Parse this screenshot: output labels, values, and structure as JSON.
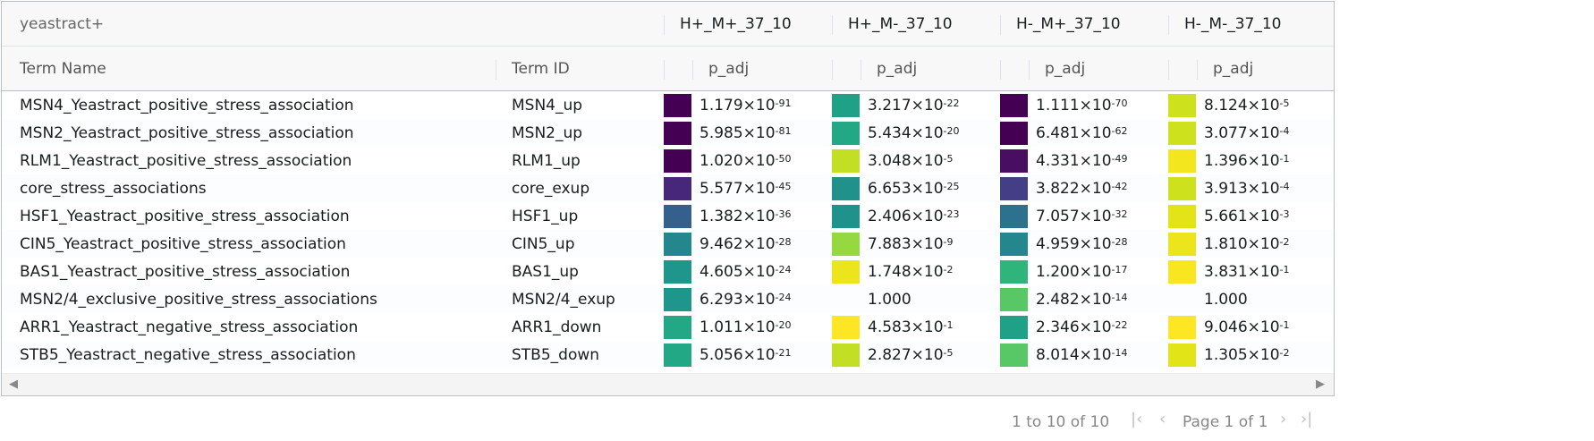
{
  "group_header": {
    "title": "yeastract+",
    "columns": [
      "H+_M+_37_10",
      "H+_M-_37_10",
      "H-_M+_37_10",
      "H-_M-_37_10"
    ]
  },
  "column_header": {
    "term_name": "Term Name",
    "term_id": "Term ID",
    "p_adj": [
      "p_adj",
      "p_adj",
      "p_adj",
      "p_adj"
    ]
  },
  "rows": [
    {
      "name": "MSN4_Yeastract_positive_stress_association",
      "id": "MSN4_up",
      "cells": [
        {
          "color": "#440154",
          "m": "1.179×10",
          "e": "-91"
        },
        {
          "color": "#1fa188",
          "m": "3.217×10",
          "e": "-22"
        },
        {
          "color": "#440154",
          "m": "1.111×10",
          "e": "-70"
        },
        {
          "color": "#cde11d",
          "m": "8.124×10",
          "e": "-5"
        }
      ]
    },
    {
      "name": "MSN2_Yeastract_positive_stress_association",
      "id": "MSN2_up",
      "cells": [
        {
          "color": "#440154",
          "m": "5.985×10",
          "e": "-81"
        },
        {
          "color": "#22a884",
          "m": "5.434×10",
          "e": "-20"
        },
        {
          "color": "#440154",
          "m": "6.481×10",
          "e": "-62"
        },
        {
          "color": "#cde11d",
          "m": "3.077×10",
          "e": "-4"
        }
      ]
    },
    {
      "name": "RLM1_Yeastract_positive_stress_association",
      "id": "RLM1_up",
      "cells": [
        {
          "color": "#440154",
          "m": "1.020×10",
          "e": "-50"
        },
        {
          "color": "#c2df23",
          "m": "3.048×10",
          "e": "-5"
        },
        {
          "color": "#470e61",
          "m": "4.331×10",
          "e": "-49"
        },
        {
          "color": "#f4e61e",
          "m": "1.396×10",
          "e": "-1"
        }
      ]
    },
    {
      "name": "core_stress_associations",
      "id": "core_exup",
      "cells": [
        {
          "color": "#46277a",
          "m": "5.577×10",
          "e": "-45"
        },
        {
          "color": "#21918c",
          "m": "6.653×10",
          "e": "-25"
        },
        {
          "color": "#433e85",
          "m": "3.822×10",
          "e": "-42"
        },
        {
          "color": "#cde11d",
          "m": "3.913×10",
          "e": "-4"
        }
      ]
    },
    {
      "name": "HSF1_Yeastract_positive_stress_association",
      "id": "HSF1_up",
      "cells": [
        {
          "color": "#355f8d",
          "m": "1.382×10",
          "e": "-36"
        },
        {
          "color": "#20928c",
          "m": "2.406×10",
          "e": "-23"
        },
        {
          "color": "#2c728e",
          "m": "7.057×10",
          "e": "-32"
        },
        {
          "color": "#e2e418",
          "m": "5.661×10",
          "e": "-3"
        }
      ]
    },
    {
      "name": "CIN5_Yeastract_positive_stress_association",
      "id": "CIN5_up",
      "cells": [
        {
          "color": "#24878e",
          "m": "9.462×10",
          "e": "-28"
        },
        {
          "color": "#95d840",
          "m": "7.883×10",
          "e": "-9"
        },
        {
          "color": "#24878e",
          "m": "4.959×10",
          "e": "-28"
        },
        {
          "color": "#ece51b",
          "m": "1.810×10",
          "e": "-2"
        }
      ]
    },
    {
      "name": "BAS1_Yeastract_positive_stress_association",
      "id": "BAS1_up",
      "cells": [
        {
          "color": "#1f968b",
          "m": "4.605×10",
          "e": "-24"
        },
        {
          "color": "#ece51b",
          "m": "1.748×10",
          "e": "-2"
        },
        {
          "color": "#2fb47c",
          "m": "1.200×10",
          "e": "-17"
        },
        {
          "color": "#f8e621",
          "m": "3.831×10",
          "e": "-1"
        }
      ]
    },
    {
      "name": "MSN2/4_exclusive_positive_stress_associations",
      "id": "MSN2/4_exup",
      "cells": [
        {
          "color": "#1f968b",
          "m": "6.293×10",
          "e": "-24"
        },
        {
          "color": "",
          "m": "1.000",
          "e": ""
        },
        {
          "color": "#58c765",
          "m": "2.482×10",
          "e": "-14"
        },
        {
          "color": "",
          "m": "1.000",
          "e": ""
        }
      ]
    },
    {
      "name": "ARR1_Yeastract_negative_stress_association",
      "id": "ARR1_down",
      "cells": [
        {
          "color": "#22a884",
          "m": "1.011×10",
          "e": "-20"
        },
        {
          "color": "#fde725",
          "m": "4.583×10",
          "e": "-1"
        },
        {
          "color": "#1fa188",
          "m": "2.346×10",
          "e": "-22"
        },
        {
          "color": "#fde725",
          "m": "9.046×10",
          "e": "-1"
        }
      ]
    },
    {
      "name": "STB5_Yeastract_negative_stress_association",
      "id": "STB5_down",
      "cells": [
        {
          "color": "#22a884",
          "m": "5.056×10",
          "e": "-21"
        },
        {
          "color": "#c2df23",
          "m": "2.827×10",
          "e": "-5"
        },
        {
          "color": "#58c765",
          "m": "8.014×10",
          "e": "-14"
        },
        {
          "color": "#e2e418",
          "m": "1.305×10",
          "e": "-2"
        }
      ]
    }
  ],
  "pagination": {
    "summary": "1 to 10 of 10",
    "page_label": "Page 1 of 1",
    "icons": [
      "first-page-icon",
      "previous-page-icon",
      "next-page-icon",
      "last-page-icon"
    ]
  },
  "scrollbar": {
    "icons": [
      "scroll-left-icon",
      "scroll-right-icon"
    ]
  }
}
